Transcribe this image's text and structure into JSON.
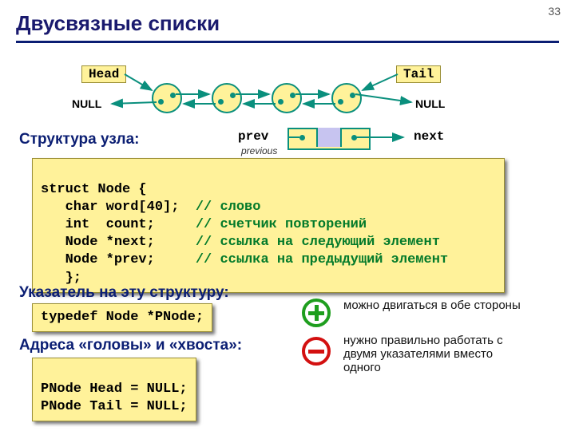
{
  "page_number": "33",
  "title": "Двусвязные списки",
  "diagram": {
    "head_label": "Head",
    "tail_label": "Tail",
    "null_left": "NULL",
    "null_right": "NULL"
  },
  "subheadings": {
    "structure": "Структура узла:",
    "pointer": "Указатель на эту структуру:",
    "addresses": "Адреса «головы» и «хвоста»:"
  },
  "node_struct": {
    "prev": "prev",
    "next": "next",
    "previous_note": "previous"
  },
  "code": {
    "line1": "struct Node {",
    "line2a": "   char word[40];  ",
    "line2b": "// слово",
    "line3a": "   int  count;     ",
    "line3b": "// счетчик повторений",
    "line4a": "   Node *next;     ",
    "line4b": "// ссылка на следующий элемент",
    "line5a": "   Node *prev;     ",
    "line5b": "// ссылка на предыдущий элемент",
    "line6": "   };"
  },
  "code_typedef": "typedef Node *PNode;",
  "code_headtail_1": "PNode Head = NULL;",
  "code_headtail_2": "PNode Tail = NULL;",
  "notes": {
    "plus": "можно двигаться в обе стороны",
    "minus": "нужно правильно работать с двумя указателями вместо одного"
  }
}
